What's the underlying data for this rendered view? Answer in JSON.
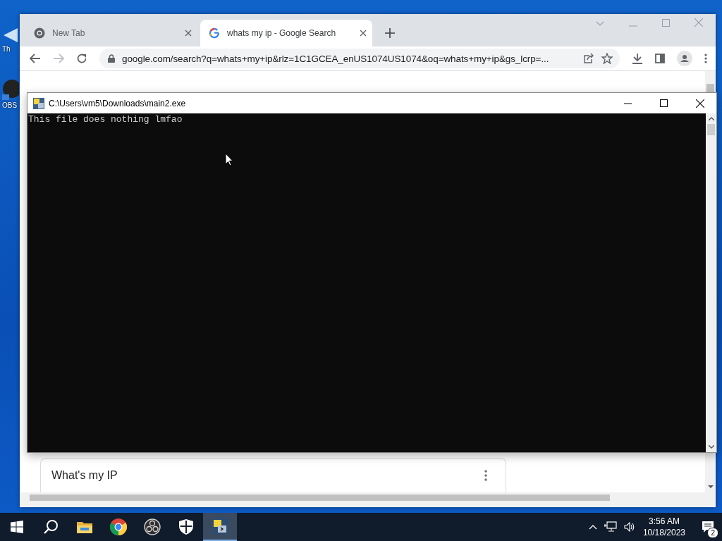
{
  "desktop_icons": [
    {
      "label": "Th"
    },
    {
      "label": "OBS"
    }
  ],
  "browser": {
    "tabs": [
      {
        "title": "New Tab",
        "selected": false
      },
      {
        "title": "whats my ip - Google Search",
        "selected": true
      }
    ],
    "address": "google.com/search?q=whats+my+ip&rlz=1C1GCEA_enUS1074US1074&oq=whats+my+ip&gs_lcrp=...",
    "result_card": {
      "title": "What's my IP"
    }
  },
  "console": {
    "title": "C:\\Users\\vm5\\Downloads\\main2.exe",
    "output": [
      "This file does nothing lmfao"
    ]
  },
  "taskbar": {
    "apps": [
      {
        "kind": "start",
        "selected": false
      },
      {
        "kind": "search",
        "selected": false
      },
      {
        "kind": "explorer",
        "selected": false
      },
      {
        "kind": "chrome",
        "selected": false
      },
      {
        "kind": "obs",
        "selected": false
      },
      {
        "kind": "security",
        "selected": false
      },
      {
        "kind": "python",
        "selected": true
      }
    ],
    "time": "3:56 AM",
    "date": "10/18/2023",
    "notifications": "2"
  }
}
